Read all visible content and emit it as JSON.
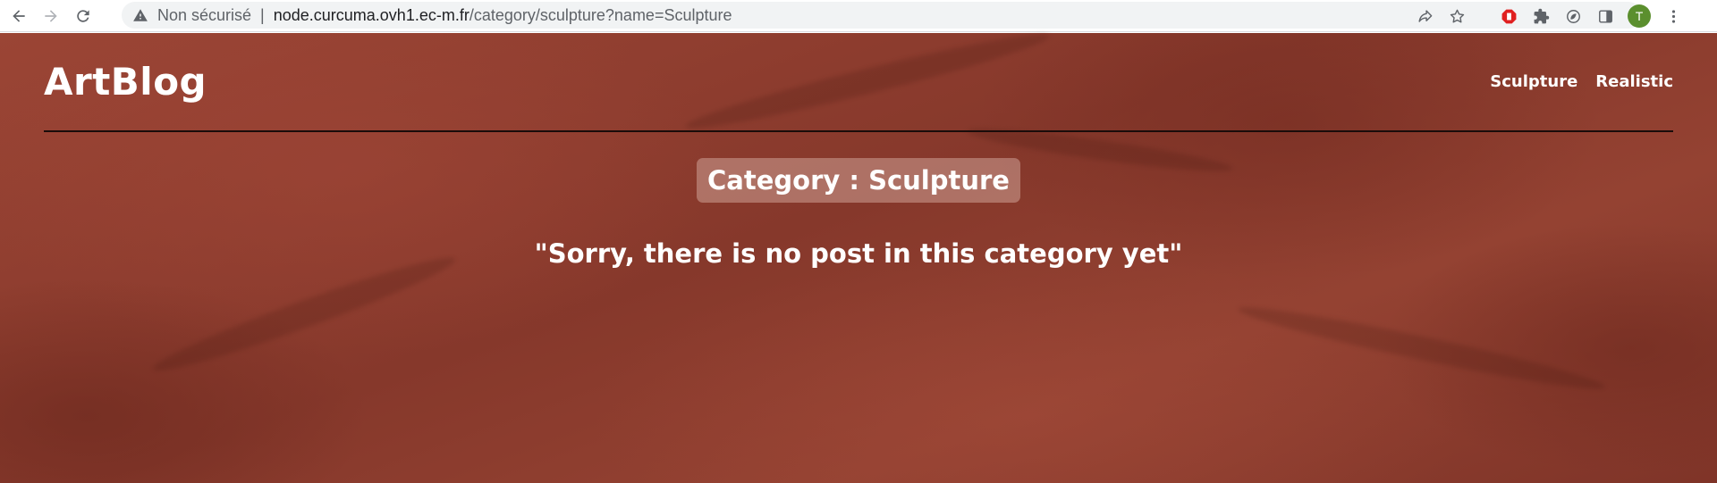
{
  "browser": {
    "security_label": "Non sécurisé",
    "url_host": "node.curcuma.ovh1.ec-m.fr",
    "url_path": "/category/sculpture?name=Sculpture",
    "profile_initial": "T",
    "profile_color": "#5b8f2e",
    "icons": [
      "back-icon",
      "forward-icon",
      "reload-icon",
      "warning-icon",
      "share-icon",
      "star-icon",
      "adblock-icon",
      "extensions-icon",
      "leaf-icon",
      "side-panel-icon",
      "menu-icon"
    ]
  },
  "site": {
    "logo": "ArtBlog",
    "nav": [
      {
        "label": "Sculpture"
      },
      {
        "label": "Realistic"
      }
    ]
  },
  "main": {
    "category_heading": "Category : Sculpture",
    "empty_message": "\"Sorry, there is no post in this category yet\""
  },
  "colors": {
    "background": "#8e3c2f",
    "text": "#ffffff",
    "rule": "#1a0c0a"
  }
}
